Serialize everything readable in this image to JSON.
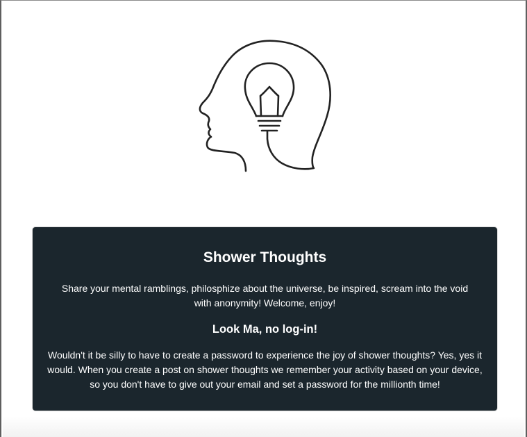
{
  "hero": {
    "logo_icon": "head-lightbulb-icon"
  },
  "welcome_card": {
    "title": "Shower Thoughts",
    "intro": "Share your mental ramblings, philosphize about the universe, be inspired, scream into the void with anonymity! Welcome, enjoy!",
    "subtitle": "Look Ma, no log-in!",
    "body": "Wouldn't it be silly to have to create a password to experience the joy of shower thoughts? Yes, yes it would. When you create a post on shower thoughts we remember your activity based on your device, so you don't have to give out your email and set a password for the millionth time!"
  },
  "colors": {
    "card_background": "#1b262d",
    "card_text": "#ffffff",
    "page_background": "#ffffff",
    "logo_stroke": "#222222"
  }
}
